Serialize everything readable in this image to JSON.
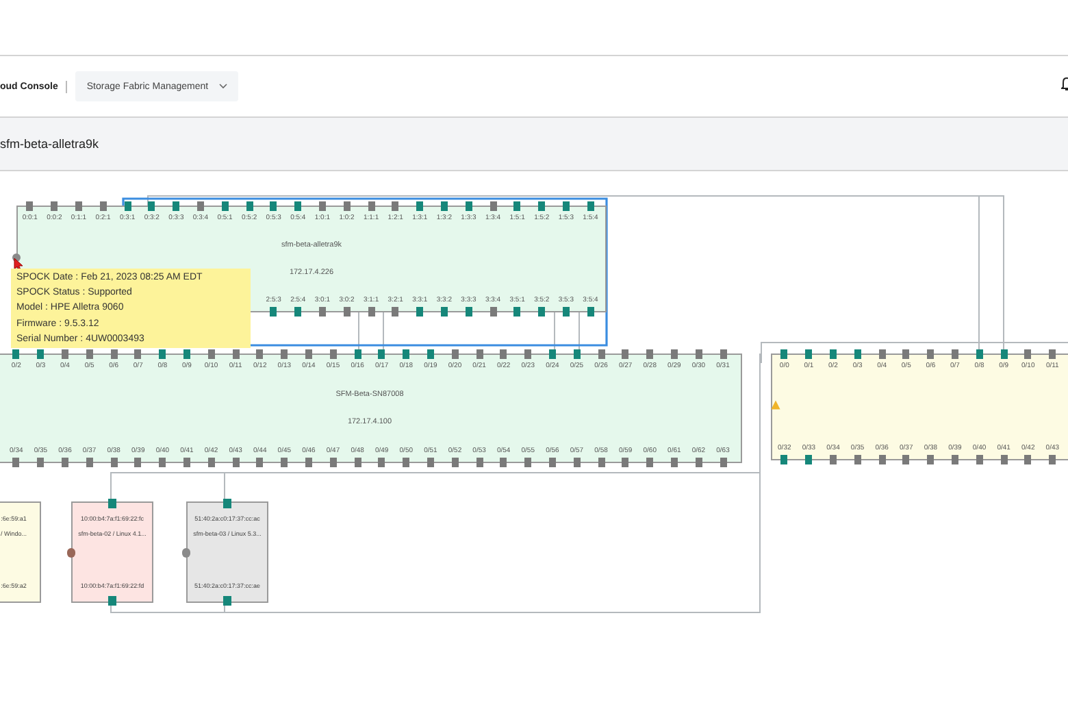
{
  "header": {
    "app_name": "oud Console",
    "service_menu": {
      "label": "Storage Fabric Management"
    }
  },
  "title_bar": {
    "title": "sfm-beta-alletra9k"
  },
  "topology": {
    "devices": [
      {
        "warning": false,
        "name": "sfm-beta-alletra9k",
        "ip": "172.17.4.226",
        "top_ports": [
          {
            "label": "0:0:1",
            "connected": false
          },
          {
            "label": "0:0:2",
            "connected": false
          },
          {
            "label": "0:1:1",
            "connected": false
          },
          {
            "label": "0:2:1",
            "connected": false
          },
          {
            "label": "0:3:1",
            "connected": true
          },
          {
            "label": "0:3:2",
            "connected": true
          },
          {
            "label": "0:3:3",
            "connected": true
          },
          {
            "label": "0:3:4",
            "connected": false
          },
          {
            "label": "0:5:1",
            "connected": true
          },
          {
            "label": "0:5:2",
            "connected": true
          },
          {
            "label": "0:5:3",
            "connected": true
          },
          {
            "label": "0:5:4",
            "connected": true
          },
          {
            "label": "1:0:1",
            "connected": false
          },
          {
            "label": "1:0:2",
            "connected": false
          },
          {
            "label": "1:1:1",
            "connected": false
          },
          {
            "label": "1:2:1",
            "connected": false
          },
          {
            "label": "1:3:1",
            "connected": true
          },
          {
            "label": "1:3:2",
            "connected": true
          },
          {
            "label": "1:3:3",
            "connected": true
          },
          {
            "label": "1:3:4",
            "connected": false
          },
          {
            "label": "1:5:1",
            "connected": true
          },
          {
            "label": "1:5:2",
            "connected": true
          },
          {
            "label": "1:5:3",
            "connected": true
          },
          {
            "label": "1:5:4",
            "connected": true
          }
        ],
        "bottom_ports": [
          {
            "label": "2:5:3",
            "connected": true
          },
          {
            "label": "2:5:4",
            "connected": true
          },
          {
            "label": "3:0:1",
            "connected": false
          },
          {
            "label": "3:0:2",
            "connected": false
          },
          {
            "label": "3:1:1",
            "connected": false
          },
          {
            "label": "3:2:1",
            "connected": false
          },
          {
            "label": "3:3:1",
            "connected": true
          },
          {
            "label": "3:3:2",
            "connected": true
          },
          {
            "label": "3:3:3",
            "connected": true
          },
          {
            "label": "3:3:4",
            "connected": false
          },
          {
            "label": "3:5:1",
            "connected": true
          },
          {
            "label": "3:5:2",
            "connected": true
          },
          {
            "label": "3:5:3",
            "connected": true
          },
          {
            "label": "3:5:4",
            "connected": true
          }
        ]
      },
      {
        "warning": false,
        "name": "SFM-Beta-SN87008",
        "ip": "172.17.4.100",
        "top_ports": [
          {
            "label": "0/2",
            "connected": true
          },
          {
            "label": "0/3",
            "connected": true
          },
          {
            "label": "0/4",
            "connected": false
          },
          {
            "label": "0/5",
            "connected": false
          },
          {
            "label": "0/6",
            "connected": false
          },
          {
            "label": "0/7",
            "connected": false
          },
          {
            "label": "0/8",
            "connected": true
          },
          {
            "label": "0/9",
            "connected": true
          },
          {
            "label": "0/10",
            "connected": false
          },
          {
            "label": "0/11",
            "connected": false
          },
          {
            "label": "0/12",
            "connected": false
          },
          {
            "label": "0/13",
            "connected": false
          },
          {
            "label": "0/14",
            "connected": false
          },
          {
            "label": "0/15",
            "connected": false
          },
          {
            "label": "0/16",
            "connected": true
          },
          {
            "label": "0/17",
            "connected": true
          },
          {
            "label": "0/18",
            "connected": true
          },
          {
            "label": "0/19",
            "connected": true
          },
          {
            "label": "0/20",
            "connected": false
          },
          {
            "label": "0/21",
            "connected": false
          },
          {
            "label": "0/22",
            "connected": false
          },
          {
            "label": "0/23",
            "connected": false
          },
          {
            "label": "0/24",
            "connected": true
          },
          {
            "label": "0/25",
            "connected": true
          },
          {
            "label": "0/26",
            "connected": false
          },
          {
            "label": "0/27",
            "connected": false
          },
          {
            "label": "0/28",
            "connected": false
          },
          {
            "label": "0/29",
            "connected": false
          },
          {
            "label": "0/30",
            "connected": false
          },
          {
            "label": "0/31",
            "connected": false
          }
        ],
        "bottom_ports": [
          {
            "label": "0/34",
            "connected": false
          },
          {
            "label": "0/35",
            "connected": false
          },
          {
            "label": "0/36",
            "connected": false
          },
          {
            "label": "0/37",
            "connected": false
          },
          {
            "label": "0/38",
            "connected": false
          },
          {
            "label": "0/39",
            "connected": false
          },
          {
            "label": "0/40",
            "connected": false
          },
          {
            "label": "0/41",
            "connected": false
          },
          {
            "label": "0/42",
            "connected": false
          },
          {
            "label": "0/43",
            "connected": false
          },
          {
            "label": "0/44",
            "connected": false
          },
          {
            "label": "0/45",
            "connected": false
          },
          {
            "label": "0/46",
            "connected": false
          },
          {
            "label": "0/47",
            "connected": false
          },
          {
            "label": "0/48",
            "connected": false
          },
          {
            "label": "0/49",
            "connected": false
          },
          {
            "label": "0/50",
            "connected": false
          },
          {
            "label": "0/51",
            "connected": false
          },
          {
            "label": "0/52",
            "connected": false
          },
          {
            "label": "0/53",
            "connected": false
          },
          {
            "label": "0/54",
            "connected": false
          },
          {
            "label": "0/55",
            "connected": false
          },
          {
            "label": "0/56",
            "connected": false
          },
          {
            "label": "0/57",
            "connected": false
          },
          {
            "label": "0/58",
            "connected": false
          },
          {
            "label": "0/59",
            "connected": false
          },
          {
            "label": "0/60",
            "connected": false
          },
          {
            "label": "0/61",
            "connected": false
          },
          {
            "label": "0/62",
            "connected": false
          },
          {
            "label": "0/63",
            "connected": false
          }
        ]
      },
      {
        "warning": true,
        "top_ports": [
          {
            "label": "0/0",
            "connected": true
          },
          {
            "label": "0/1",
            "connected": true
          },
          {
            "label": "0/2",
            "connected": true
          },
          {
            "label": "0/3",
            "connected": true
          },
          {
            "label": "0/4",
            "connected": false
          },
          {
            "label": "0/5",
            "connected": false
          },
          {
            "label": "0/6",
            "connected": false
          },
          {
            "label": "0/7",
            "connected": false
          },
          {
            "label": "0/8",
            "connected": true
          },
          {
            "label": "0/9",
            "connected": true
          },
          {
            "label": "0/10",
            "connected": false
          },
          {
            "label": "0/11",
            "connected": false
          }
        ],
        "bottom_ports": [
          {
            "label": "0/32",
            "connected": true
          },
          {
            "label": "0/33",
            "connected": true
          },
          {
            "label": "0/34",
            "connected": false
          },
          {
            "label": "0/35",
            "connected": false
          },
          {
            "label": "0/36",
            "connected": false
          },
          {
            "label": "0/37",
            "connected": false
          },
          {
            "label": "0/38",
            "connected": false
          },
          {
            "label": "0/39",
            "connected": false
          },
          {
            "label": "0/40",
            "connected": false
          },
          {
            "label": "0/41",
            "connected": false
          },
          {
            "label": "0/42",
            "connected": false
          },
          {
            "label": "0/43",
            "connected": false
          }
        ]
      }
    ],
    "hosts": [
      {
        "color": "#fdfbe3",
        "wwn_top": ":6e:59:a1",
        "name": "/ Windo...",
        "wwn_bottom": ":6e:59:a2"
      },
      {
        "color": "#fde4e2",
        "wwn_top": "10:00:b4:7a:f1:69:22:fc",
        "name": "sfm-beta-02 / Linux 4.1...",
        "wwn_bottom": "10:00:b4:7a:f1:69:22:fd",
        "ports": [
          {
            "connected": true
          },
          {
            "connected": true
          }
        ]
      },
      {
        "color": "#e6e6e6",
        "wwn_top": "51:40:2a:c0:17:37:cc:ac",
        "name": "sfm-beta-03 / Linux 5.3...",
        "wwn_bottom": "51:40:2a:c0:17:37:cc:ae",
        "ports": [
          {
            "connected": true
          },
          {
            "connected": true
          }
        ]
      }
    ],
    "tooltip": {
      "lines": [
        "SPOCK Date : Feb 21, 2023 08:25 AM EDT",
        "SPOCK Status : Supported",
        "Model : HPE Alletra 9060",
        "Firmware : 9.5.3.12",
        "Serial Number : 4UW0003493"
      ]
    }
  }
}
